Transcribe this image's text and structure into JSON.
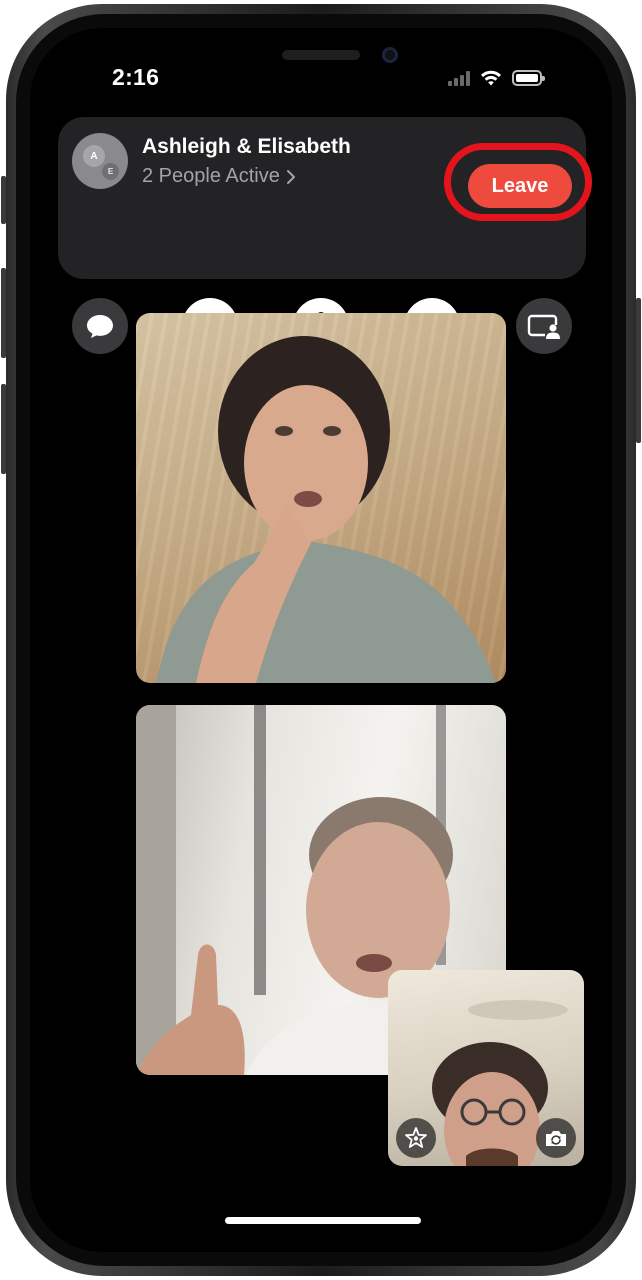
{
  "status_bar": {
    "time": "2:16"
  },
  "call": {
    "title": "Ashleigh & Elisabeth",
    "subtitle": "2 People Active",
    "avatar_initials": [
      "A",
      "E"
    ],
    "leave_label": "Leave",
    "leave_color": "#ee4a3e",
    "highlight_color": "#e4141c"
  },
  "controls": [
    {
      "name": "messages",
      "icon": "message-bubble-icon",
      "style": "dark"
    },
    {
      "name": "audio",
      "icon": "speaker-icon",
      "style": "light"
    },
    {
      "name": "microphone",
      "icon": "microphone-icon",
      "style": "light"
    },
    {
      "name": "camera",
      "icon": "video-camera-icon",
      "style": "light"
    },
    {
      "name": "shareplay",
      "icon": "shareplay-icon",
      "style": "dark"
    }
  ],
  "video_tiles": [
    {
      "participant": "participant-1"
    },
    {
      "participant": "participant-2"
    }
  ],
  "self_view": {
    "effects_icon": "effects-star-icon",
    "flip_icon": "flip-camera-icon"
  }
}
